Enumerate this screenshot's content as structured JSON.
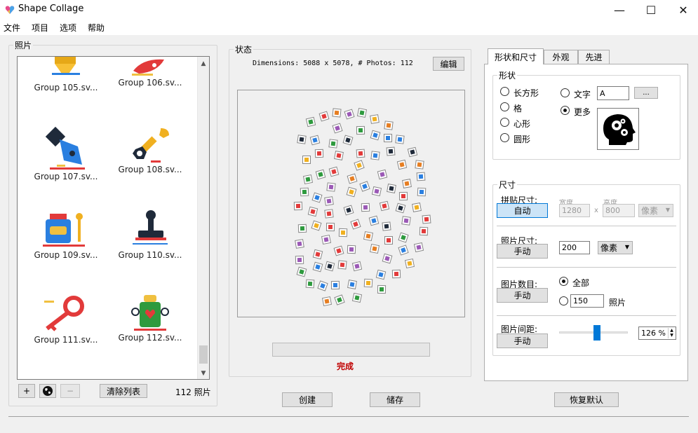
{
  "window": {
    "title": "Shape Collage",
    "minimize": "—",
    "maximize": "☐",
    "close": "✕"
  },
  "menu": [
    "文件",
    "项目",
    "选项",
    "帮助"
  ],
  "photos": {
    "legend": "照片",
    "items": [
      {
        "caption": "Group 105.sv..."
      },
      {
        "caption": "Group 106.sv..."
      },
      {
        "caption": "Group 107.sv..."
      },
      {
        "caption": "Group 108.sv..."
      },
      {
        "caption": "Group 109.sv..."
      },
      {
        "caption": "Group 110.sv..."
      },
      {
        "caption": "Group 111.sv..."
      },
      {
        "caption": "Group 112.sv..."
      }
    ],
    "add_label": "+",
    "remove_label": "−",
    "clear_label": "清除列表",
    "count": "112 照片"
  },
  "status": {
    "legend": "状态",
    "dimensions": "Dimensions: 5088 x 5078, # Photos: 112",
    "edit_label": "编辑",
    "done": "完成"
  },
  "actions": {
    "create": "创建",
    "save": "储存",
    "reset": "恢复默认"
  },
  "tabs": [
    {
      "label": "形状和尺寸",
      "active": true
    },
    {
      "label": "外观",
      "active": false
    },
    {
      "label": "先进",
      "active": false
    }
  ],
  "shape": {
    "legend": "形状",
    "options": [
      "长方形",
      "格",
      "心形",
      "圆形"
    ],
    "text_option": "文字",
    "text_value": "A",
    "browse_label": "...",
    "more_option": "更多",
    "selected": "更多",
    "preview_icon": "head-gears-icon"
  },
  "size": {
    "legend": "尺寸",
    "paste_size_label": "拼贴尺寸:",
    "paste_size_btn": "自动",
    "width_label": "宽度",
    "height_label": "高度",
    "width_value": "1280",
    "height_value": "800",
    "x_sep": "x",
    "unit_disabled": "像素",
    "photo_size_label": "照片尺寸:",
    "photo_size_btn": "手动",
    "photo_size_value": "200",
    "photo_size_unit": "像素",
    "photo_count_label": "图片数目:",
    "photo_count_btn": "手动",
    "all_option": "全部",
    "count_value": "150",
    "count_unit": "照片",
    "spacing_label": "图片间距:",
    "spacing_btn": "手动",
    "spacing_value": "126 %",
    "spacing_level": 0.55
  },
  "colors": {
    "accent": "#0078d7",
    "done": "#c00000"
  }
}
